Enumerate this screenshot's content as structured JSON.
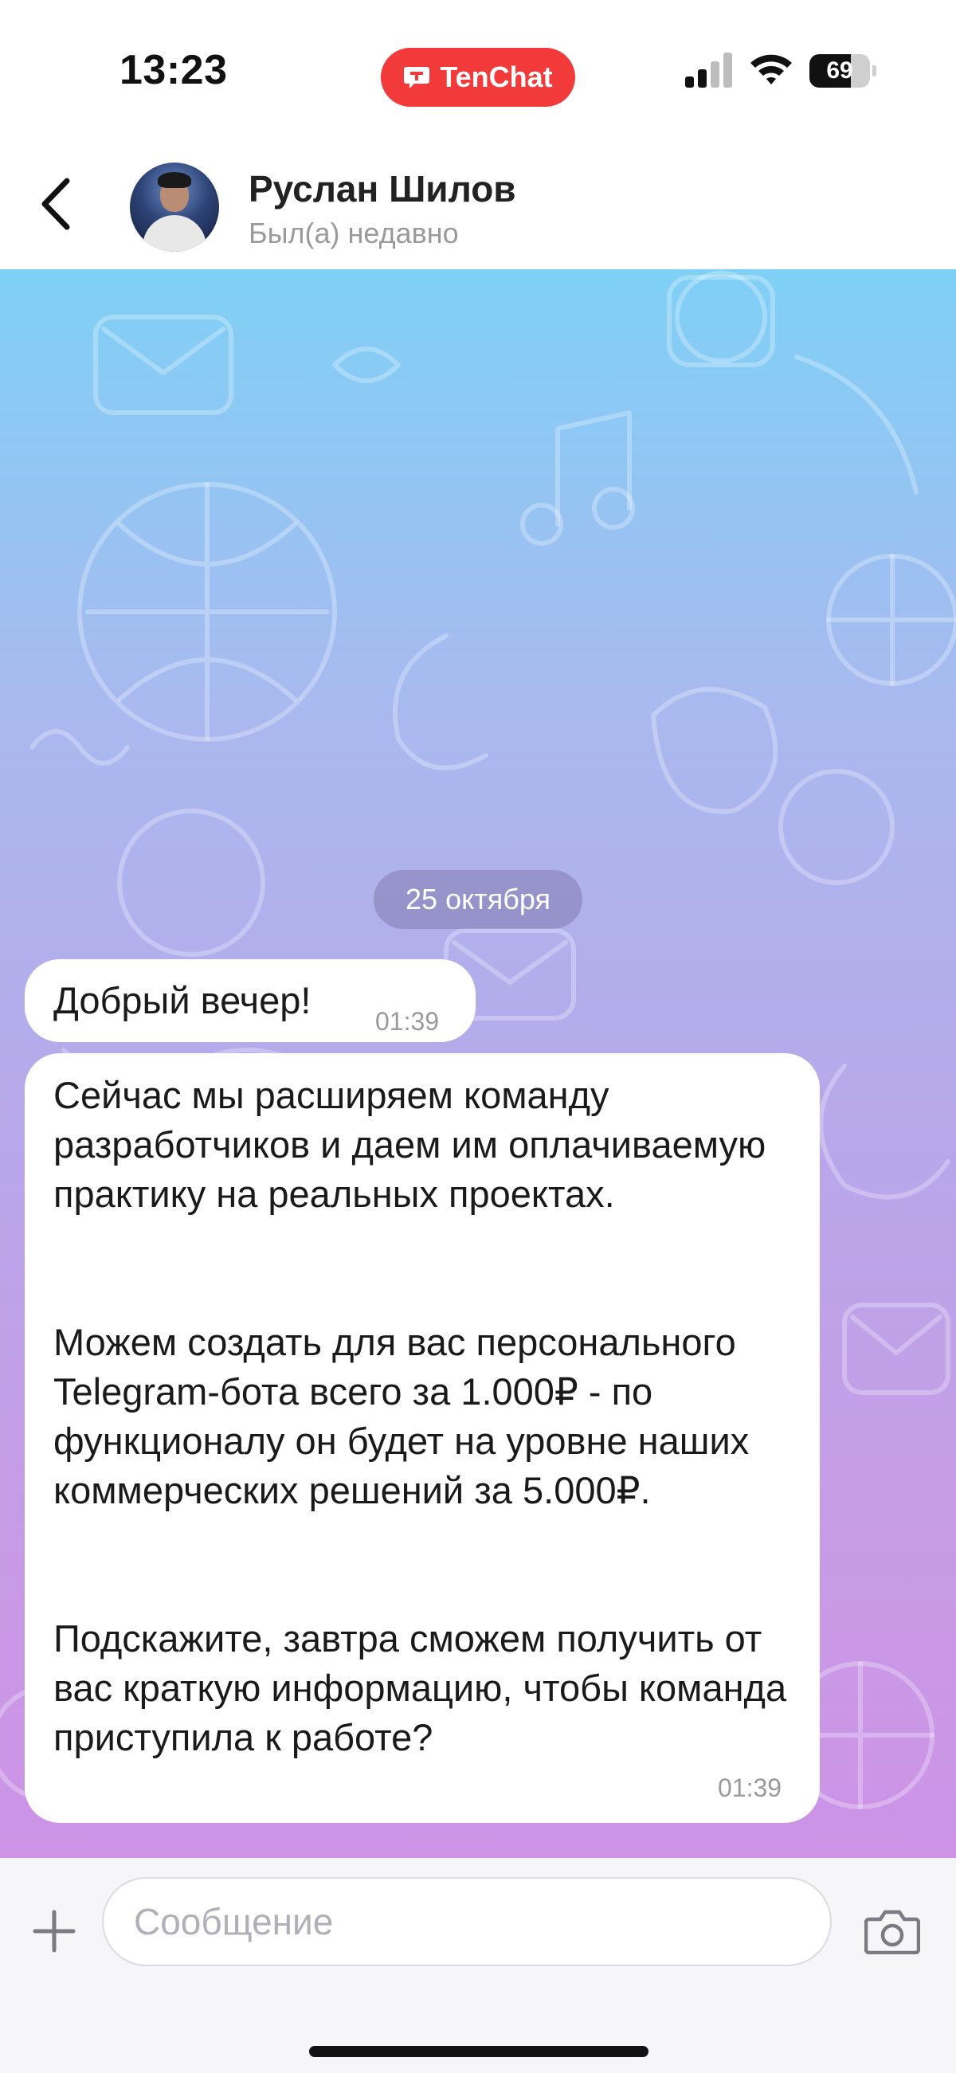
{
  "status_bar": {
    "time": "13:23",
    "app_label": "TenChat",
    "battery": "69",
    "battery_level": 0.69
  },
  "header": {
    "name": "Руслан Шилов",
    "status": "Был(а) недавно"
  },
  "chat": {
    "date": "25 октября",
    "messages": [
      {
        "text": "Добрый вечер!",
        "time": "01:39"
      },
      {
        "paragraphs": [
          "Сейчас мы расширяем команду разработчиков и даем им оплачиваемую практику на реальных проектах.",
          "Можем создать для вас персонального Telegram-бота всего за 1.000₽ - по функционалу он будет на уровне наших коммерческих решений за 5.000₽.",
          "Подскажите, завтра сможем получить от вас краткую информацию, чтобы команда приступила к работе?"
        ],
        "time": "01:39"
      }
    ]
  },
  "composer": {
    "placeholder": "Сообщение"
  },
  "colors": {
    "accent": "#f23a3a",
    "gradient_top": "#7fd0f6",
    "gradient_bottom": "#cd93e6"
  }
}
